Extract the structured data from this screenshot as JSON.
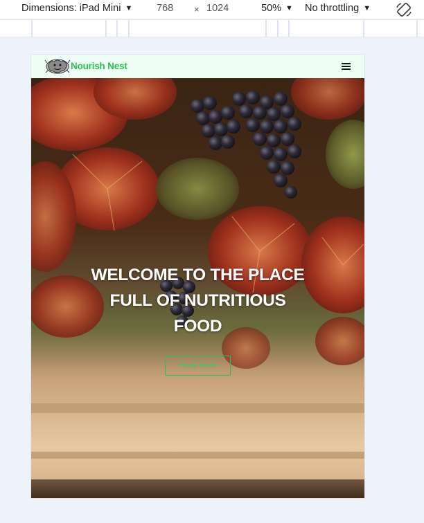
{
  "devtools": {
    "dimensions_label": "Dimensions: iPad Mini",
    "width": "768",
    "times": "×",
    "height": "1024",
    "zoom": "50%",
    "throttling": "No throttling",
    "icons": {
      "dropdown": "caret-down-icon",
      "rotate": "rotate-icon"
    }
  },
  "site": {
    "brand": "Nourish Nest",
    "brand_color": "#2bbf5c",
    "nav_background": "#f0fff6",
    "logo_icon": "lion-logo-icon",
    "menu_icon": "hamburger-menu-icon",
    "hero": {
      "line1": "WELCOME TO THE PLACE",
      "line2": "FULL OF NUTRITIOUS",
      "line3": "FOOD",
      "button_label": "Read More",
      "background": "vineyard-grapes-autumn-leaves"
    }
  }
}
